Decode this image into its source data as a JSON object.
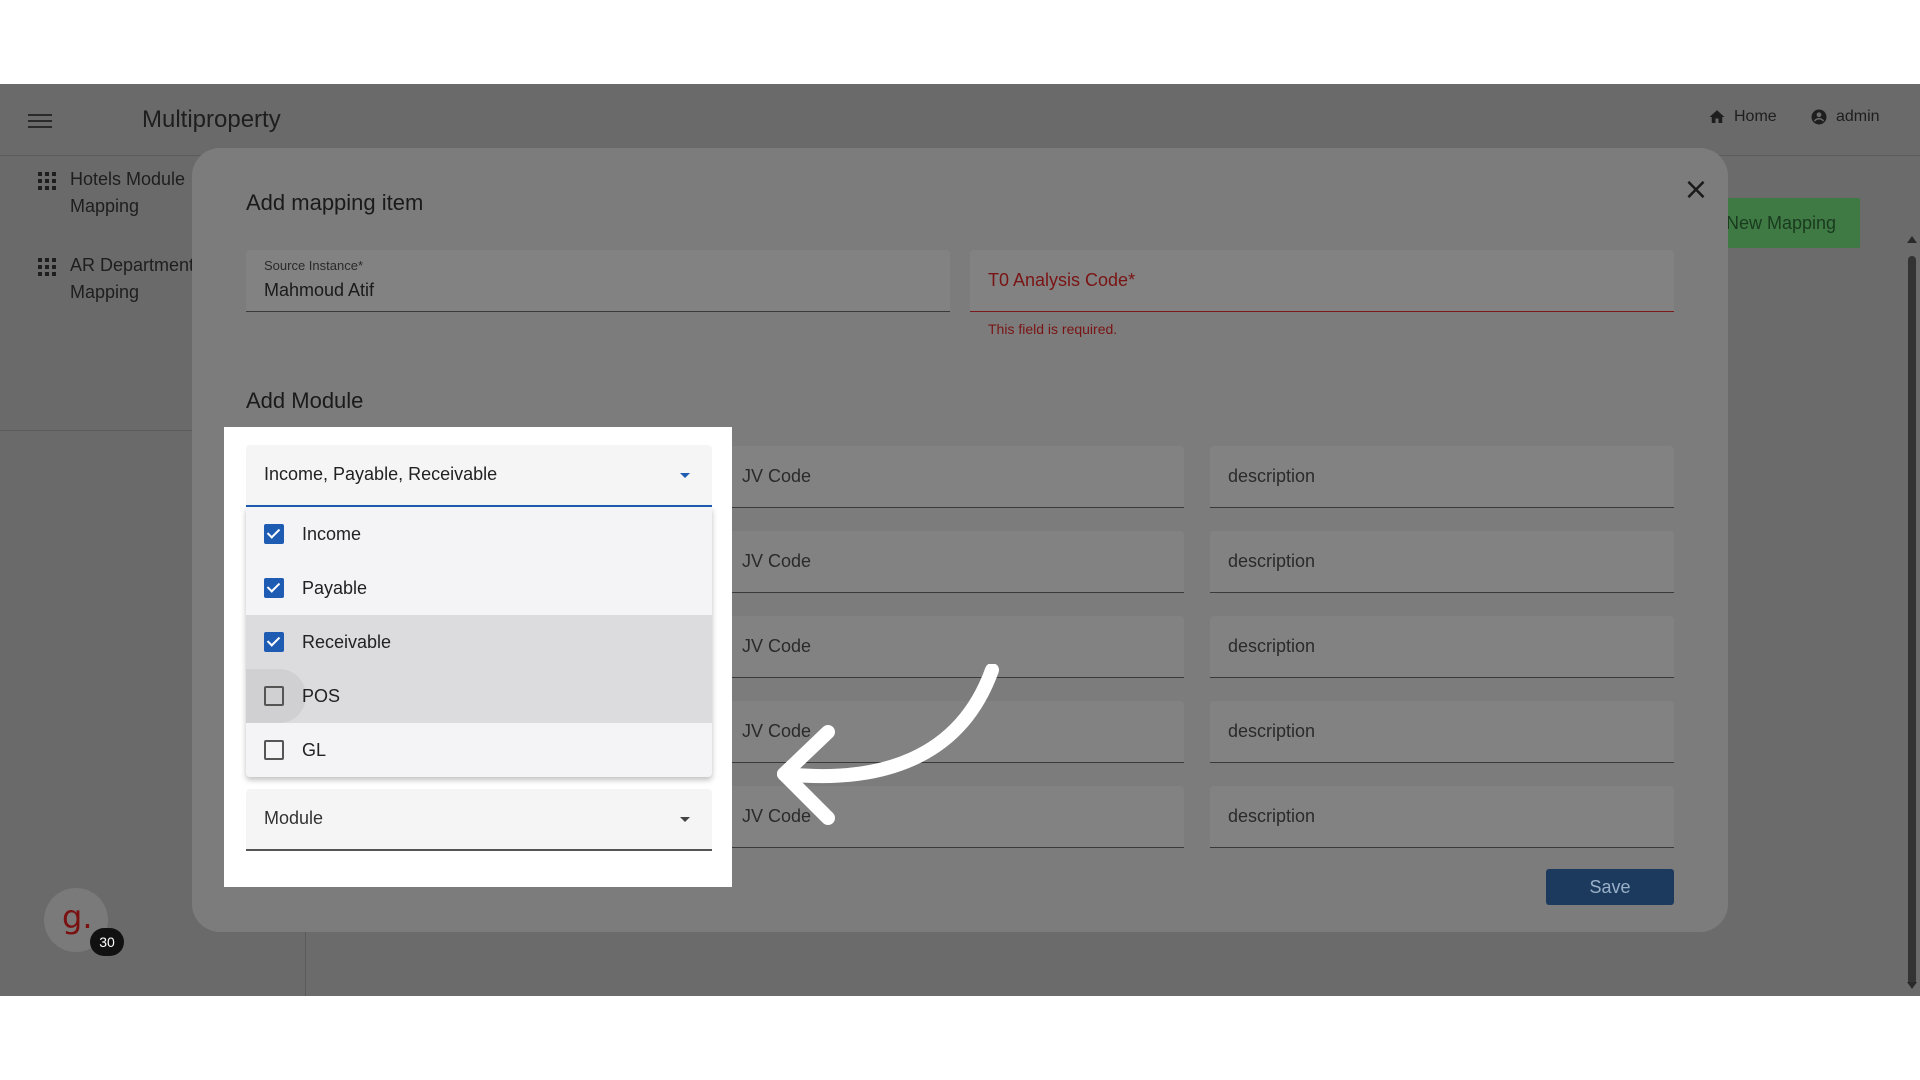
{
  "app": {
    "title": "Multiproperty"
  },
  "nav": {
    "home": "Home",
    "admin": "admin"
  },
  "sidebar": {
    "items": [
      {
        "label_line1": "Hotels Module",
        "label_line2": "Mapping"
      },
      {
        "label_line1": "AR Department",
        "label_line2": "Mapping"
      }
    ]
  },
  "toolbar": {
    "new_mapping": "New Mapping"
  },
  "badge": {
    "letter": "g.",
    "count": "30"
  },
  "modal": {
    "title": "Add mapping item",
    "close": "×",
    "source_instance": {
      "label": "Source Instance*",
      "value": "Mahmoud Atif"
    },
    "analysis_code": {
      "placeholder": "T0 Analysis Code*",
      "error": "This field is required."
    },
    "section_title": "Add Module",
    "rows": [
      {
        "jv": "JV Code",
        "desc": "description"
      },
      {
        "jv": "JV Code",
        "desc": "description"
      },
      {
        "jv": "JV Code",
        "desc": "description"
      },
      {
        "jv": "JV Code",
        "desc": "description"
      },
      {
        "jv": "JV Code",
        "desc": "description"
      }
    ],
    "save": "Save"
  },
  "module_select": {
    "selected_text": "Income, Payable, Receivable",
    "options": [
      {
        "label": "Income",
        "checked": true
      },
      {
        "label": "Payable",
        "checked": true
      },
      {
        "label": "Receivable",
        "checked": true
      },
      {
        "label": "POS",
        "checked": false
      },
      {
        "label": "GL",
        "checked": false
      }
    ],
    "empty_placeholder": "Module"
  },
  "colors": {
    "accent": "#1e5cb3",
    "error": "#b71c1c",
    "success": "#4caf50",
    "save": "#1e4f8a"
  }
}
